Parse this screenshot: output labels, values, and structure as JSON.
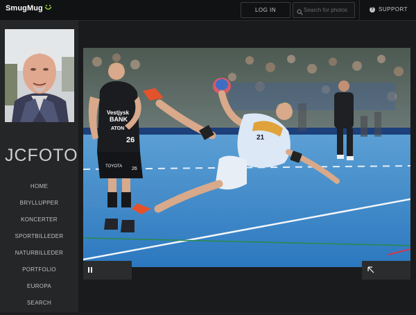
{
  "header": {
    "logo_text": "SmugMug",
    "login_label": "LOG IN",
    "search_placeholder": "Search for photos",
    "support_label": "SUPPORT"
  },
  "sidebar": {
    "site_name": "JCFOTO",
    "nav": [
      {
        "label": "HOME"
      },
      {
        "label": "BRYLLUPPER"
      },
      {
        "label": "KONCERTER"
      },
      {
        "label": "SPORTBILLEDER"
      },
      {
        "label": "NATURBILLEDER"
      },
      {
        "label": "PORTFOLIO"
      },
      {
        "label": "EUROPA"
      },
      {
        "label": "SEARCH"
      }
    ]
  },
  "photo": {
    "jersey_numbers": [
      "26",
      "21"
    ],
    "sponsor_text": [
      "Vestjysk BANK",
      "ATON",
      "TOYOTA"
    ]
  },
  "colors": {
    "accent": "#8dc63f",
    "court_blue": "#3a86c7",
    "background": "#1c1d1f"
  },
  "icons": [
    "smugmug-smile-icon",
    "search-icon",
    "help-icon",
    "pause-icon",
    "expand-icon"
  ]
}
